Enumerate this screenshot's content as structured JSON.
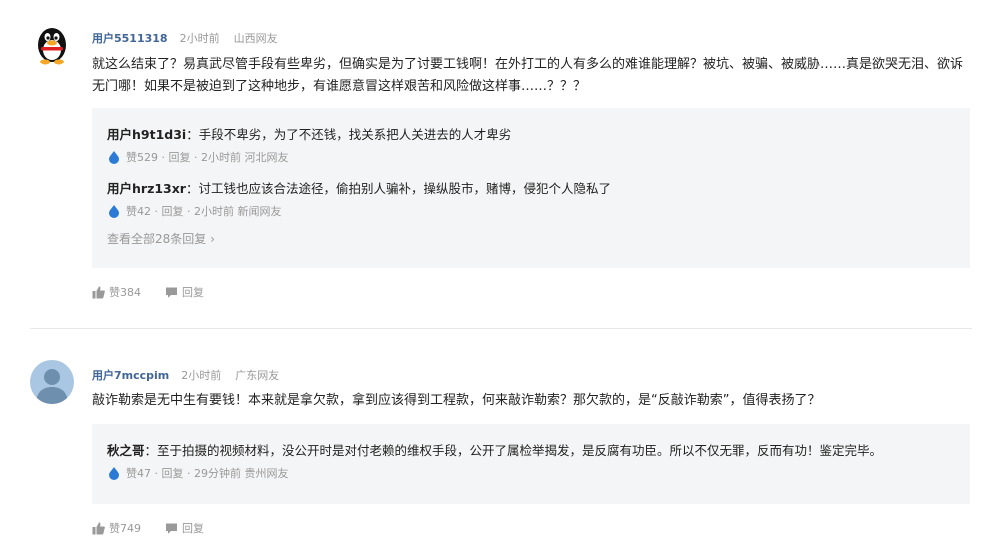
{
  "comments": [
    {
      "user": "用户5511318",
      "time": "2小时前",
      "location": "山西网友",
      "text": "就这么结束了？易真武尽管手段有些卑劣，但确实是为了讨要工钱啊！在外打工的人有多么的难谁能理解？被坑、被骗、被威胁……真是欲哭无泪、欲诉无门哪！如果不是被迫到了这种地步，有谁愿意冒这样艰苦和风险做这样事……？？？",
      "replies": [
        {
          "user": "用户h9t1d3i",
          "sep": "：",
          "text": "手段不卑劣，为了不还钱，找关系把人关进去的人才卑劣",
          "likes": "赞529",
          "reply_label": "回复",
          "time": "2小时前",
          "location": "河北网友"
        },
        {
          "user": "用户hrz13xr",
          "sep": "：",
          "text": "讨工钱也应该合法途径，偷拍别人骗补，操纵股市，赌博，侵犯个人隐私了",
          "likes": "赞42",
          "reply_label": "回复",
          "time": "2小时前",
          "location": "新闻网友"
        }
      ],
      "view_all": "查看全部28条回复",
      "likes": "赞384",
      "reply_label": "回复"
    },
    {
      "user": "用户7mccpim",
      "time": "2小时前",
      "location": "广东网友",
      "text": "敲诈勒索是无中生有要钱！本来就是拿欠款，拿到应该得到工程款，何来敲诈勒索？那欠款的，是“反敲诈勒索”，值得表扬了？",
      "replies": [
        {
          "user": "秋之哥",
          "sep": "：",
          "text": "至于拍摄的视频材料，没公开时是对付老赖的维权手段，公开了属检举揭发，是反腐有功臣。所以不仅无罪，反而有功！鉴定完毕。",
          "likes": "赞47",
          "reply_label": "回复",
          "time": "29分钟前",
          "location": "贵州网友"
        }
      ],
      "likes": "赞749",
      "reply_label": "回复"
    }
  ],
  "dot": "·",
  "colors": {
    "username": "#406599",
    "reply_bg": "#f4f5f6",
    "like_drop": "#2b7bd6"
  }
}
